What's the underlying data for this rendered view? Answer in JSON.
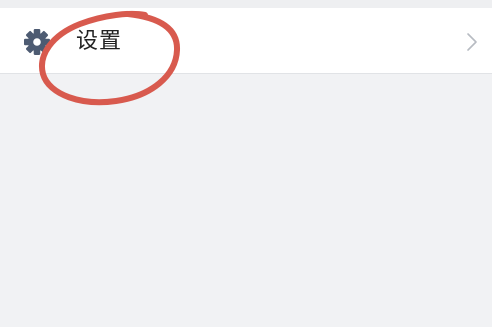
{
  "settings_row": {
    "label": "设置",
    "icon": "gear-icon",
    "chevron_icon": "chevron-right-icon"
  },
  "colors": {
    "background": "#f1f2f4",
    "row_background": "#ffffff",
    "icon": "#4d5b72",
    "chevron": "#b7bbc2",
    "annotation": "#d85a4e"
  }
}
